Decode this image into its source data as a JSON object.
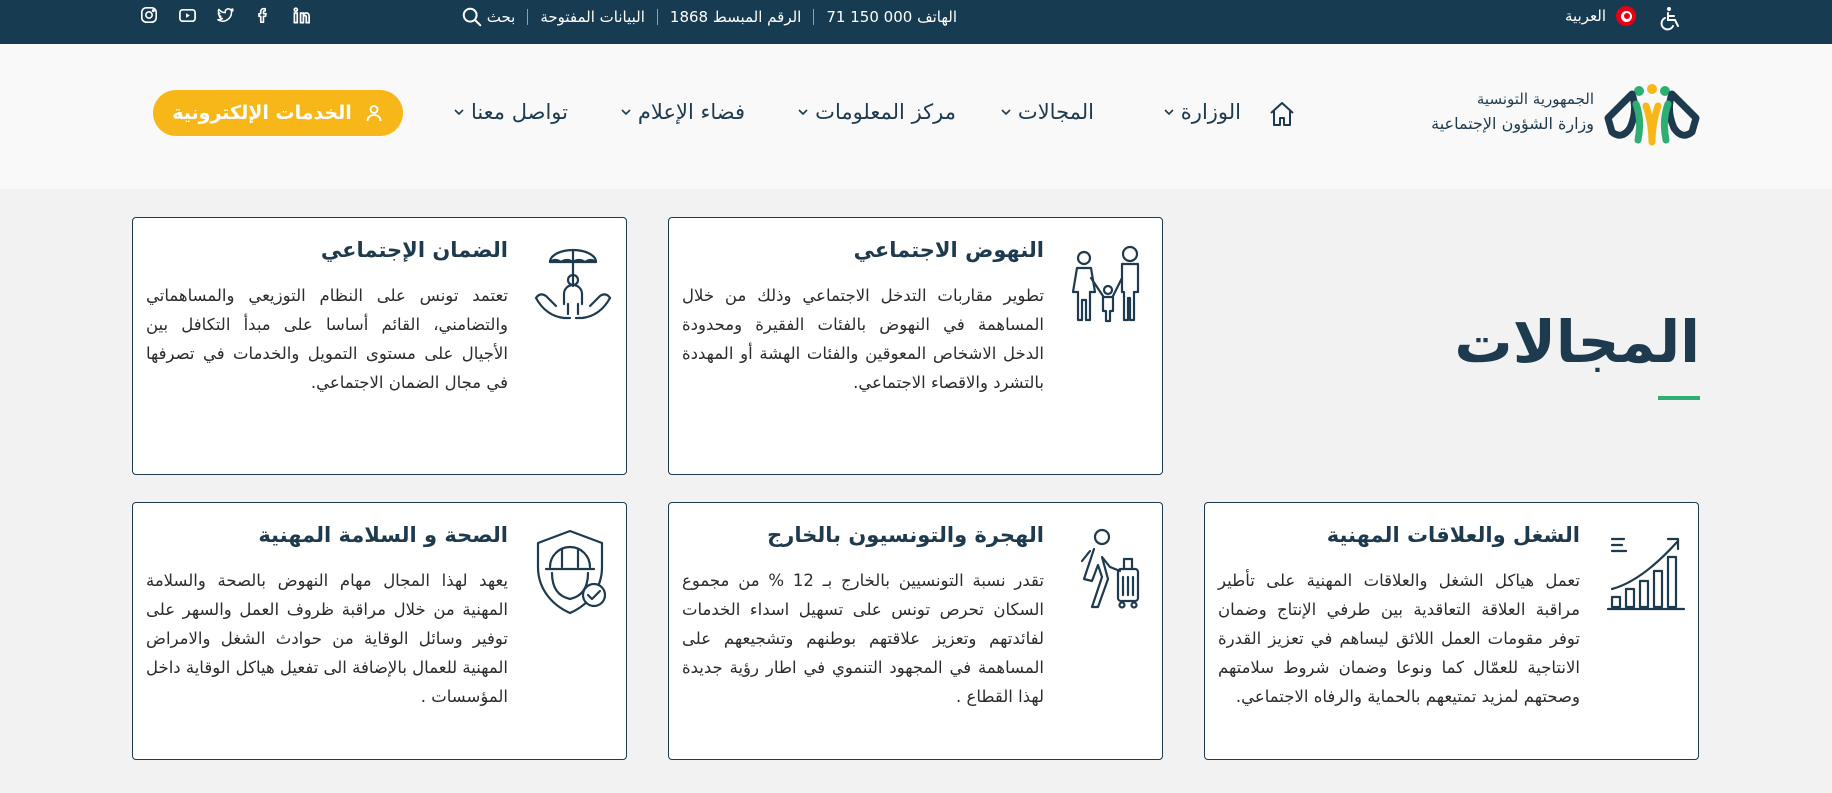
{
  "topbar": {
    "language": "العربية",
    "phone": "الهاتف 000 150 71",
    "hotline": "الرقم المبسط 1868",
    "open_data": "البيانات المفتوحة",
    "search_label": "بحث",
    "social": [
      "linkedin-icon",
      "facebook-icon",
      "twitter-icon",
      "youtube-icon",
      "instagram-icon"
    ]
  },
  "header": {
    "republic": "الجمهورية التونسية",
    "ministry": "وزارة الشؤون الإجتماعية",
    "nav": [
      "الوزارة",
      "المجالات",
      "مركز المعلومات",
      "فضاء الإعلام",
      "تواصل معنا"
    ],
    "eservices": "الخدمات الإلكترونية"
  },
  "section": {
    "title": "المجالات"
  },
  "cards": [
    {
      "title": "النهوض الاجتماعي",
      "desc": "تطوير مقاربات التدخل الاجتماعي وذلك من خلال المساهمة في النهوض بالفئات الفقيرة ومحدودة الدخل الاشخاص المعوقين والفئات الهشة أو المهددة بالتشرد والاقصاء الاجتماعي.",
      "icon": "family-icon"
    },
    {
      "title": "الضمان الإجتماعي",
      "desc": "تعتمد تونس على النظام التوزيعي والمساهماتي والتضامني، القائم أساسا على مبدأ التكافل بين الأجيال على مستوى التمويل والخدمات في تصرفها في مجال الضمان الاجتماعي.",
      "icon": "protected-person-icon"
    },
    {
      "title": "الشغل والعلاقات المهنية",
      "desc": "تعمل هياكل الشغل والعلاقات المهنية على تأطير مراقبة العلاقة التعاقدية بين طرفي الإنتاج وضمان توفر مقومات العمل اللائق ليساهم في تعزيز القدرة الانتاجية للعمّال كما ونوعا وضمان شروط سلامتهم وصحتهم لمزيد تمتيعهم بالحماية والرفاه الاجتماعي.",
      "icon": "growth-chart-icon"
    },
    {
      "title": "الهجرة والتونسيون بالخارج",
      "desc": "تقدر نسبة التونسيين بالخارج بـ 12 % من مجموع السكان تحرص تونس على تسهيل اسداء الخدمات لفائدتهم وتعزيز علاقتهم بوطنهم وتشجيعهم على المساهمة في المجهود التنموي في اطار رؤية جديدة لهذا القطاع .",
      "icon": "traveler-icon"
    },
    {
      "title": "الصحة و السلامة المهنية",
      "desc": "يعهد لهذا المجال مهام النهوض بالصحة والسلامة المهنية من خلال مراقبة ظروف العمل والسهر على توفير وسائل الوقاية من حوادث الشغل والامراض المهنية للعمال بالإضافة الى تفعيل هياكل الوقاية داخل المؤسسات .",
      "icon": "safety-helmet-icon"
    }
  ],
  "colors": {
    "topbar": "#173b51",
    "accent": "#f7b718",
    "primary": "#1e3a4f",
    "green": "#2fae73"
  }
}
